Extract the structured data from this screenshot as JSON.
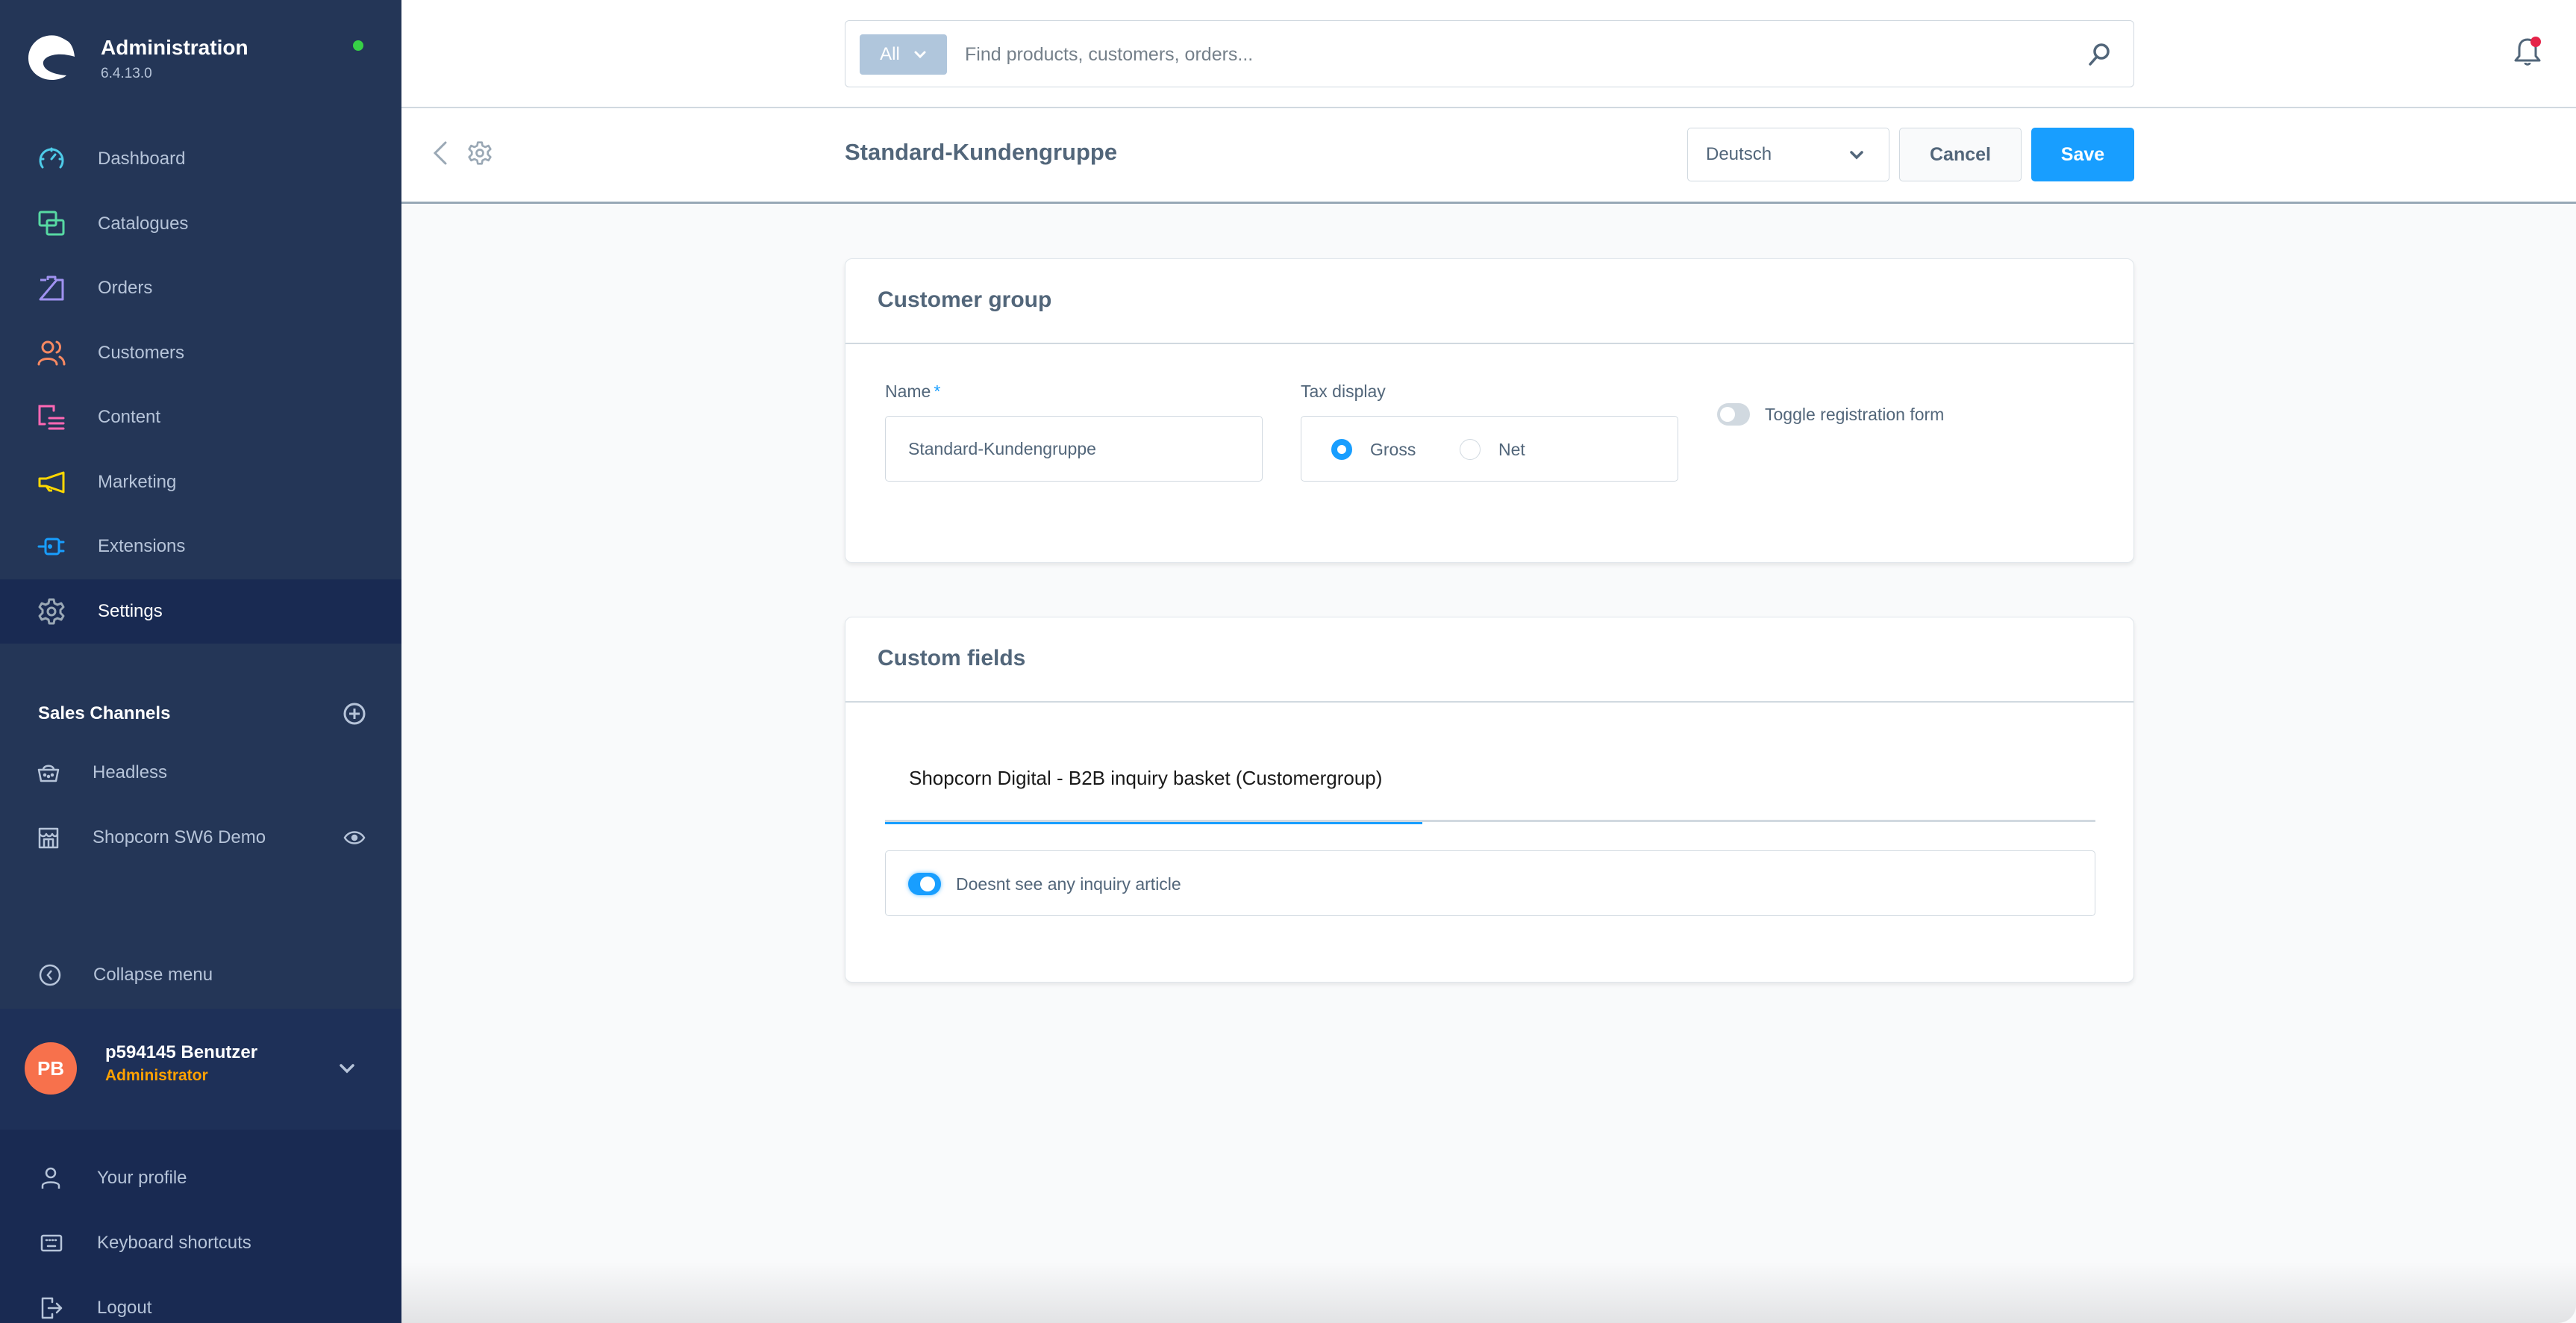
{
  "app": {
    "title": "Administration",
    "version": "6.4.13.0",
    "status_color": "#37d046"
  },
  "sidebar": {
    "nav": [
      {
        "label": "Dashboard",
        "icon": "dashboard-icon",
        "color": "#4ecbe8"
      },
      {
        "label": "Catalogues",
        "icon": "catalogues-icon",
        "color": "#57d9a3"
      },
      {
        "label": "Orders",
        "icon": "orders-icon",
        "color": "#a092f0"
      },
      {
        "label": "Customers",
        "icon": "customers-icon",
        "color": "#f88962"
      },
      {
        "label": "Content",
        "icon": "content-icon",
        "color": "#ff68b4"
      },
      {
        "label": "Marketing",
        "icon": "marketing-icon",
        "color": "#ffd700"
      },
      {
        "label": "Extensions",
        "icon": "extensions-icon",
        "color": "#189eff"
      },
      {
        "label": "Settings",
        "icon": "settings-icon",
        "color": "#9aa8b5",
        "active": true
      }
    ],
    "sales_channels": {
      "title": "Sales Channels",
      "items": [
        {
          "label": "Headless",
          "icon": "basket-icon"
        },
        {
          "label": "Shopcorn SW6 Demo",
          "icon": "storefront-icon",
          "has_preview": true
        }
      ]
    },
    "collapse_label": "Collapse menu",
    "user": {
      "initials": "PB",
      "name": "p594145 Benutzer",
      "role": "Administrator",
      "avatar_color": "#f7714c"
    },
    "user_menu": [
      {
        "label": "Your profile",
        "icon": "user-icon"
      },
      {
        "label": "Keyboard shortcuts",
        "icon": "keyboard-icon"
      },
      {
        "label": "Logout",
        "icon": "logout-icon"
      }
    ]
  },
  "search": {
    "type_label": "All",
    "placeholder": "Find products, customers, orders...",
    "value": ""
  },
  "notifications": {
    "has_unread": true
  },
  "smartbar": {
    "title": "Standard-Kundengruppe",
    "language": "Deutsch",
    "cancel_label": "Cancel",
    "save_label": "Save"
  },
  "customer_group": {
    "title": "Customer group",
    "name_label": "Name",
    "name_required_mark": "*",
    "name_value": "Standard-Kundengruppe",
    "tax_label": "Tax display",
    "tax_options": [
      {
        "label": "Gross",
        "selected": true
      },
      {
        "label": "Net",
        "selected": false
      }
    ],
    "registration_toggle_label": "Toggle registration form",
    "registration_toggle_on": false
  },
  "custom_fields": {
    "title": "Custom fields",
    "tabs": [
      {
        "label": "Shopcorn Digital - B2B inquiry basket (Customergroup)",
        "active": true
      }
    ],
    "fields": [
      {
        "label": "Doesnt see any inquiry article",
        "on": true
      }
    ]
  },
  "colors": {
    "primary": "#189eff",
    "sidebar_bg": "#243657",
    "sidebar_active_bg": "#192a52",
    "role_color": "#ffa100",
    "notification_dot": "#e52449"
  }
}
